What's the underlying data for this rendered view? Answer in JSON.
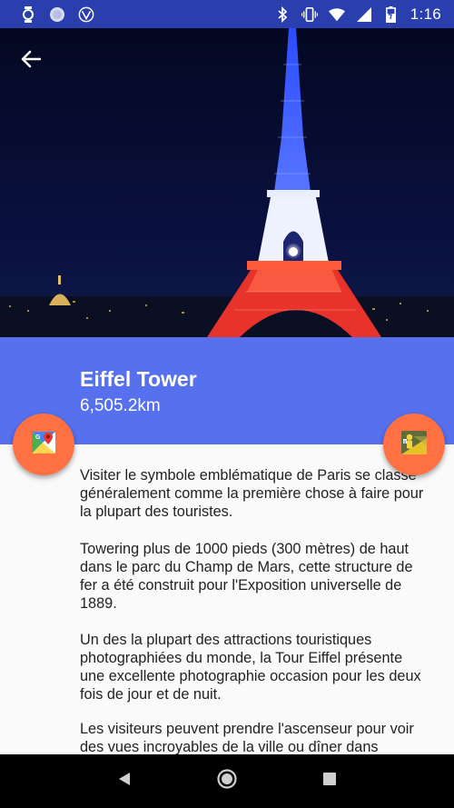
{
  "status_bar": {
    "time": "1:16",
    "left_icons": [
      "watch-icon",
      "circle-icon",
      "vpn-logo-icon"
    ],
    "right_icons": [
      "bluetooth-icon",
      "vibrate-icon",
      "wifi-icon",
      "signal-icon",
      "battery-icon"
    ]
  },
  "header": {
    "back_icon": "arrow-back-icon"
  },
  "place": {
    "title": "Eiffel Tower",
    "distance": "6,505.2km"
  },
  "fabs": {
    "left_icon": "google-maps-icon",
    "right_icon": "street-view-icon",
    "color": "#ff7043"
  },
  "description": [
    "Visiter le symbole emblématique de Paris se classe généralement comme la première chose à faire pour la plupart des touristes.",
    "Towering plus de 1000 pieds (300 mètres) de haut dans le parc du Champ de Mars, cette structure de fer a été construit pour l'Exposition universelle de 1889.",
    "Un des la plupart des attractions touristiques photographiées du monde, la Tour Eiffel présente une excellente photographie occasion pour les deux fois de jour et de nuit.",
    "Les visiteurs peuvent prendre l'ascenseur pour voir des vues incroyables de la ville ou dîner dans"
  ],
  "nav_bar": {
    "back": "nav-back-icon",
    "home": "nav-home-icon",
    "recents": "nav-recents-icon"
  },
  "colors": {
    "status_bar": "#2a3fae",
    "title_band": "#5670ee",
    "accent": "#ff7043"
  }
}
